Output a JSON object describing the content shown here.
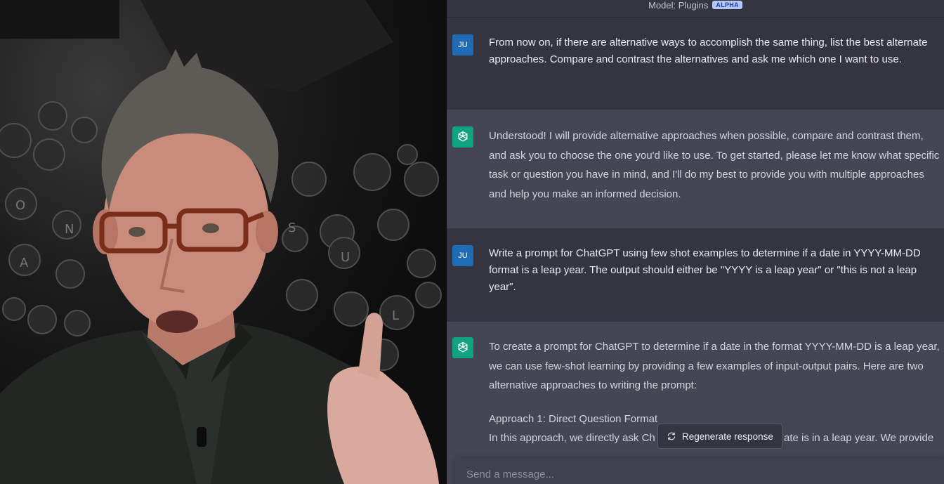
{
  "header": {
    "model_label": "Model: Plugins",
    "model_badge": "ALPHA"
  },
  "messages": [
    {
      "role": "user",
      "avatar": "JU",
      "text": "From now on, if there are alternative ways to accomplish the same thing, list the best alternate approaches. Compare and contrast the alternatives and ask me which one I want to use."
    },
    {
      "role": "assistant",
      "avatar": "openai-logo-icon",
      "text": "Understood! I will provide alternative approaches when possible, compare and contrast them, and ask you to choose the one you'd like to use. To get started, please let me know what specific task or question you have in mind, and I'll do my best to provide you with multiple approaches and help you make an informed decision."
    },
    {
      "role": "user",
      "avatar": "JU",
      "text": "Write a prompt for ChatGPT using few shot examples to determine if a date in YYYY-MM-DD format is a leap year. The output should either be \"YYYY is a leap year\" or \"this is not a leap year\"."
    },
    {
      "role": "assistant",
      "avatar": "openai-logo-icon",
      "text": "To create a prompt for ChatGPT to determine if a date in the format YYYY-MM-DD is a leap year, we can use few-shot learning by providing a few examples of input-output pairs. Here are two alternative approaches to writing the prompt:",
      "subheading": "Approach 1: Direct Question Format",
      "partial_text_left": "In this approach, we directly ask Ch",
      "partial_text_right": "ate is in a leap year. We provide"
    }
  ],
  "regenerate_label": "Regenerate response",
  "composer": {
    "placeholder": "Send a message..."
  }
}
